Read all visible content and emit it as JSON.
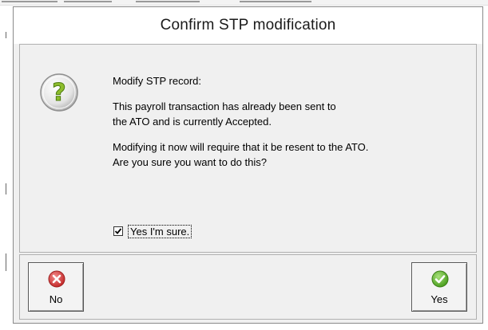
{
  "dialog": {
    "title": "Confirm STP modification",
    "message": {
      "heading": "Modify STP record:",
      "paragraph1": "This payroll transaction has already been sent to the ATO and is currently Accepted.",
      "paragraph2_line1": "Modifying it now will require that it be resent to the ATO.",
      "paragraph2_line2": "Are you sure you want to do this?"
    },
    "confirm_checkbox": {
      "label": "Yes I'm sure.",
      "checked": true
    },
    "buttons": {
      "no_label": "No",
      "yes_label": "Yes"
    },
    "icons": {
      "message": "question-icon",
      "no": "red-x-icon",
      "yes": "green-check-icon"
    },
    "colors": {
      "question_icon": "#8dbd2c",
      "no_icon": "#d63b3b",
      "yes_icon": "#5cb82a"
    }
  }
}
